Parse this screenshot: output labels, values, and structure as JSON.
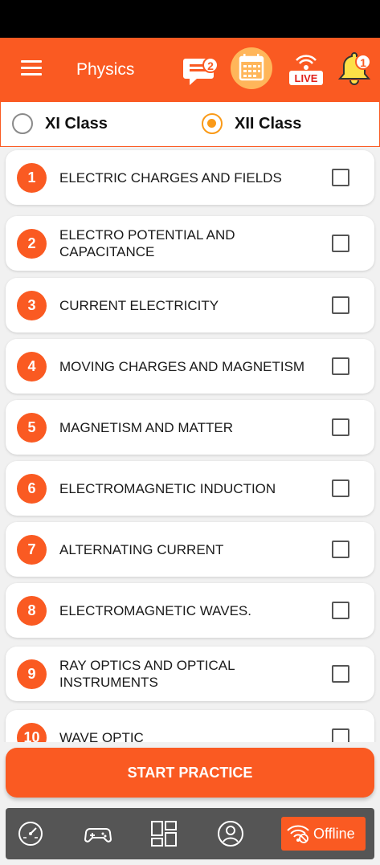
{
  "header": {
    "title": "Physics",
    "chat_badge": "2",
    "bell_badge": "1",
    "live_label": "LIVE"
  },
  "class_toggle": [
    {
      "label": "XI Class",
      "selected": false
    },
    {
      "label": "XII Class",
      "selected": true
    }
  ],
  "chapters": [
    {
      "num": "1",
      "title": "ELECTRIC CHARGES AND FIELDS"
    },
    {
      "num": "2",
      "title": "ELECTRO POTENTIAL AND CAPACITANCE"
    },
    {
      "num": "3",
      "title": "CURRENT ELECTRICITY"
    },
    {
      "num": "4",
      "title": "MOVING CHARGES AND MAGNETISM"
    },
    {
      "num": "5",
      "title": "MAGNETISM AND MATTER"
    },
    {
      "num": "6",
      "title": "ELECTROMAGNETIC INDUCTION"
    },
    {
      "num": "7",
      "title": "ALTERNATING CURRENT"
    },
    {
      "num": "8",
      "title": "ELECTROMAGNETIC WAVES."
    },
    {
      "num": "9",
      "title": "RAY OPTICS AND OPTICAL INSTRUMENTS"
    },
    {
      "num": "10",
      "title": "WAVE OPTIC"
    }
  ],
  "start_button": "START PRACTICE",
  "bottom_nav": {
    "offline_label": "Offline"
  },
  "colors": {
    "accent": "#fa5a22",
    "radio_selected": "#fa9a18",
    "nav_bg": "#555555"
  }
}
